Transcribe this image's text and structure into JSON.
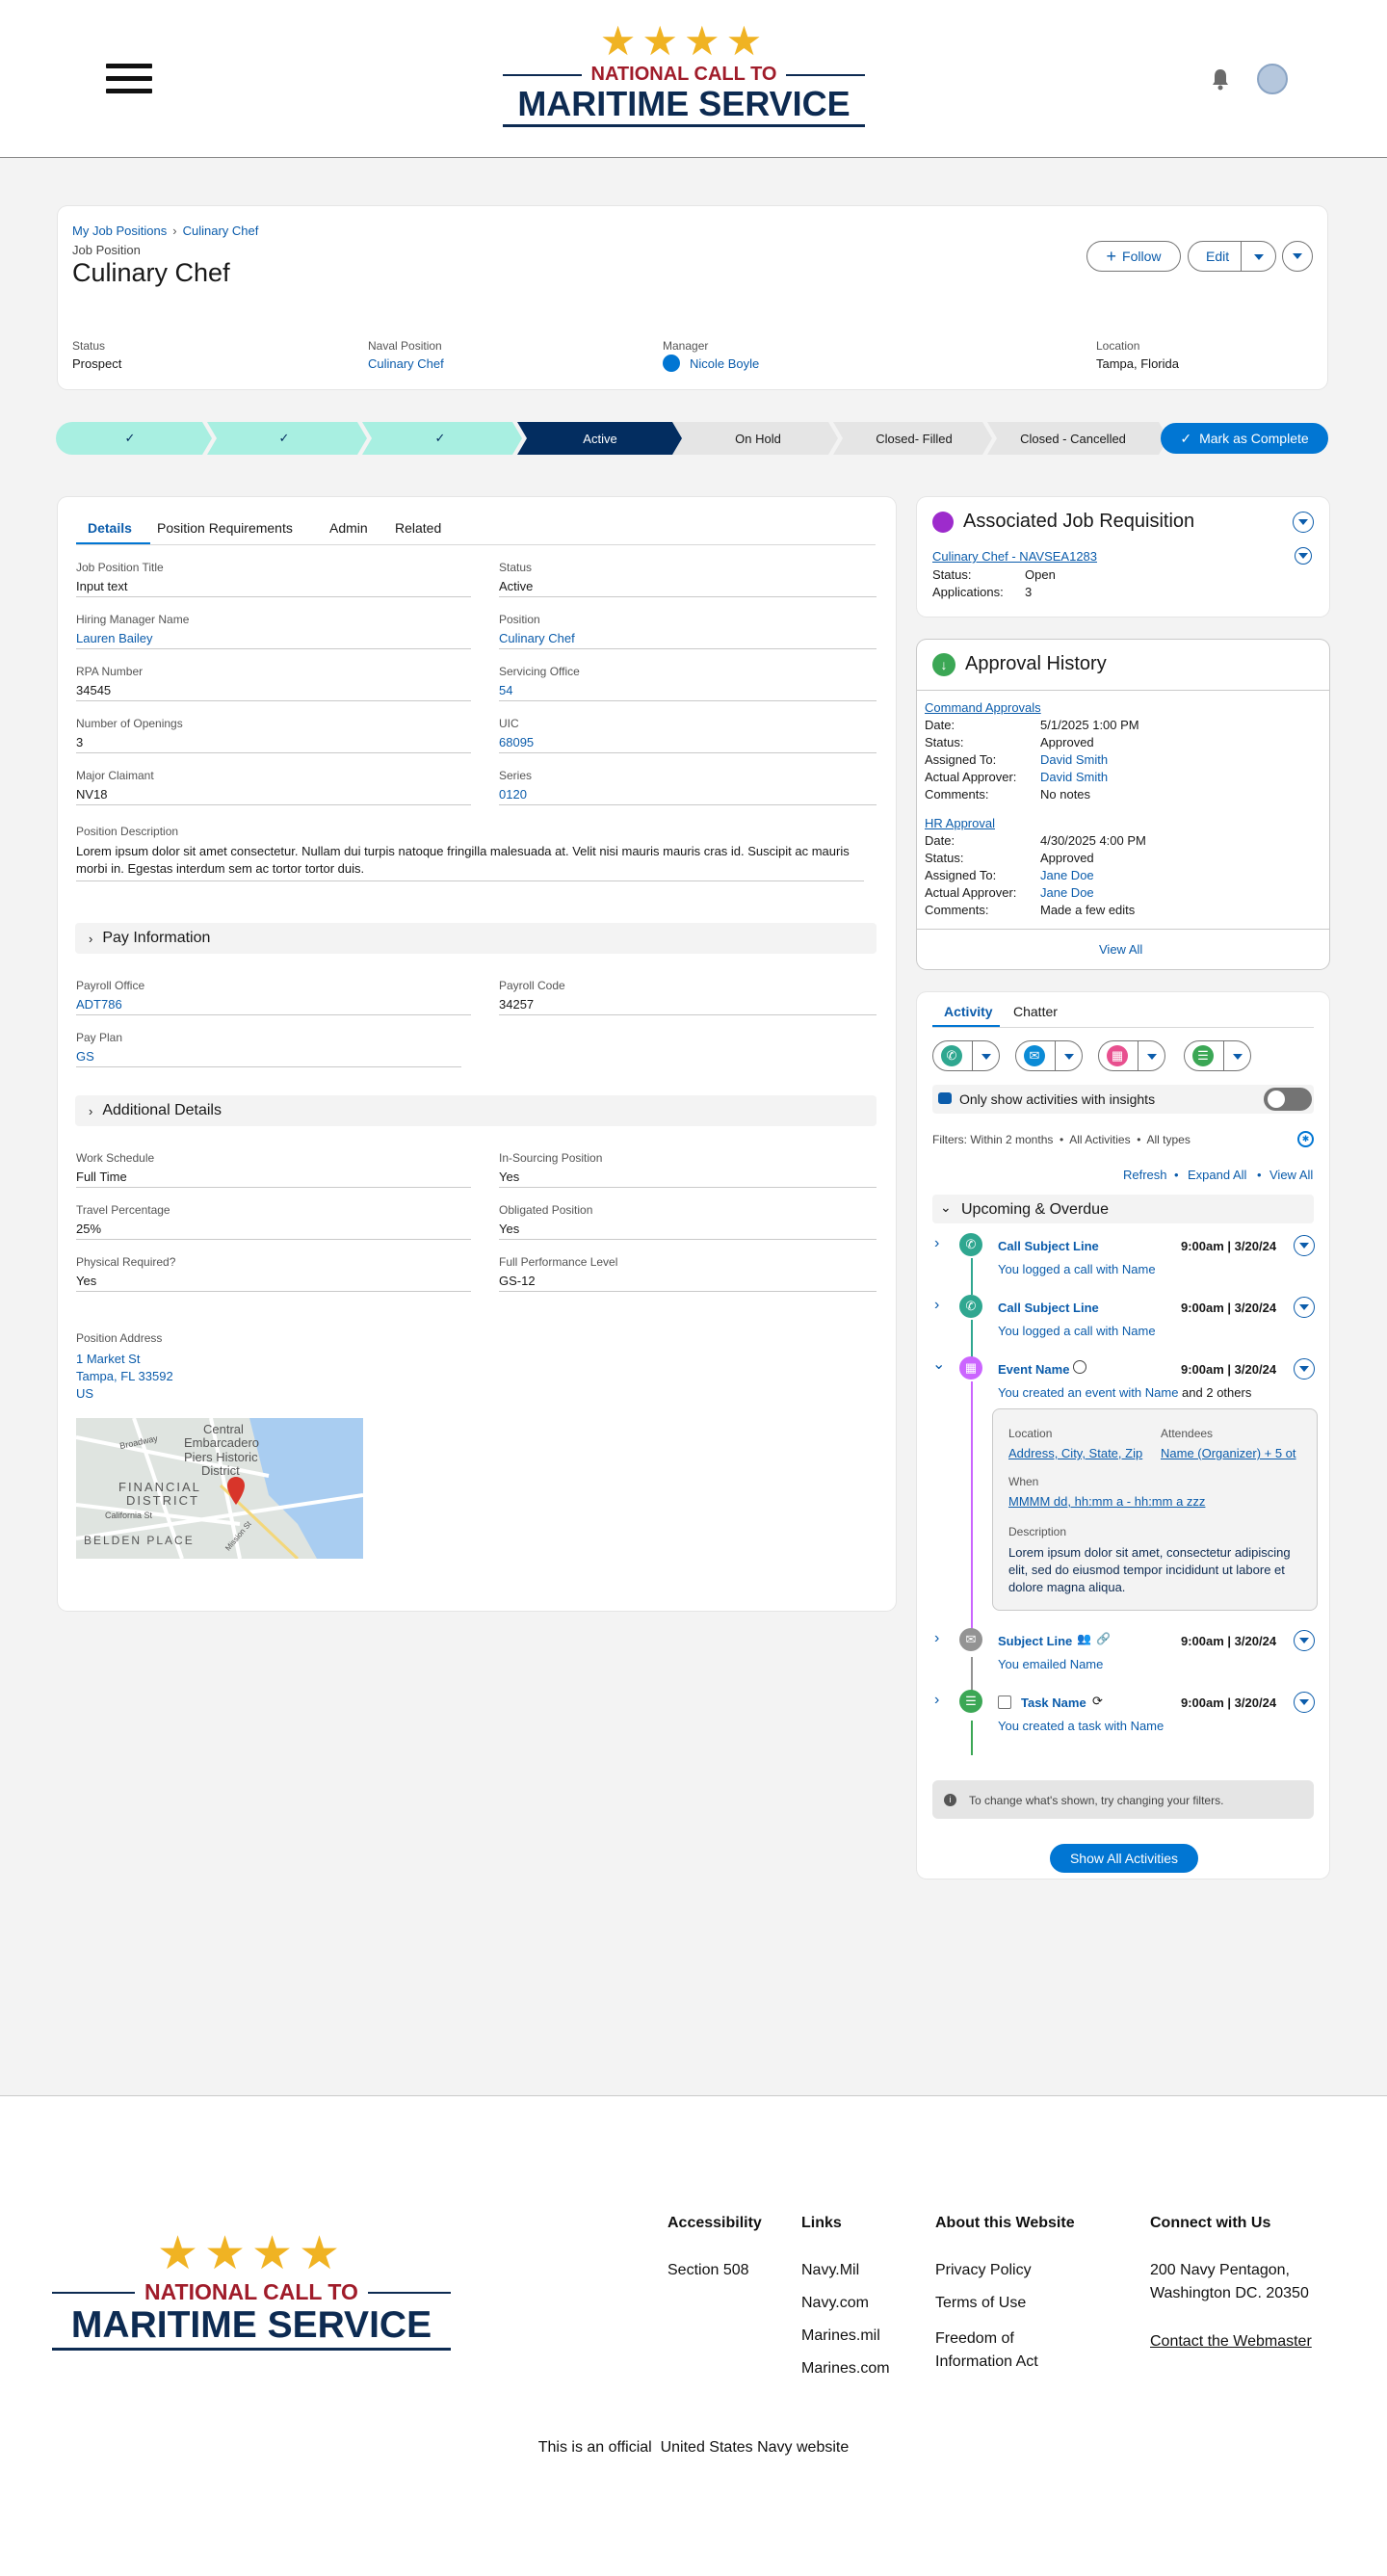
{
  "header": {
    "logo": {
      "line1": "NATIONAL CALL TO",
      "line2": "MARITIME SERVICE"
    }
  },
  "record": {
    "breadcrumb": {
      "parent": "My Job Positions",
      "current": "Culinary Chef"
    },
    "object_label": "Job Position",
    "title": "Culinary Chef",
    "actions": {
      "follow": "Follow",
      "edit": "Edit"
    },
    "highlights": [
      {
        "label": "Status",
        "value": "Prospect"
      },
      {
        "label": "Naval Position",
        "value": "Culinary Chef"
      },
      {
        "label": "Manager",
        "value": "Nicole Boyle"
      },
      {
        "label": "Location",
        "value": "Tampa, Florida"
      }
    ]
  },
  "path": {
    "stages": [
      "",
      "",
      "",
      "Active",
      "On Hold",
      "Closed- Filled",
      "Closed - Cancelled"
    ],
    "complete_button": "Mark as Complete"
  },
  "details": {
    "tabs": [
      "Details",
      "Position Requirements",
      "Admin",
      "Related"
    ],
    "fields": [
      {
        "label": "Job Position Title",
        "value": "Input text"
      },
      {
        "label": "Status",
        "value": "Active"
      },
      {
        "label": "Hiring Manager Name",
        "value": "Lauren Bailey"
      },
      {
        "label": "Position",
        "value": "Culinary Chef"
      },
      {
        "label": "RPA Number",
        "value": "34545"
      },
      {
        "label": "Servicing Office",
        "value": "54"
      },
      {
        "label": "Number of Openings",
        "value": "3"
      },
      {
        "label": "UIC",
        "value": "68095"
      },
      {
        "label": "Major Claimant",
        "value": "NV18"
      },
      {
        "label": "Series",
        "value": "0120"
      }
    ],
    "description": {
      "label": "Position Description",
      "value": "Lorem ipsum dolor sit amet consectetur. Nullam dui turpis natoque fringilla malesuada at. Velit nisi mauris mauris cras id. Suscipit ac mauris morbi in. Egestas interdum sem ac tortor tortor duis."
    },
    "pay_section": "Pay Information",
    "pay_fields": [
      {
        "label": "Payroll Office",
        "value": "ADT786"
      },
      {
        "label": "Payroll Code",
        "value": "34257"
      },
      {
        "label": "Pay Plan",
        "value": "GS"
      }
    ],
    "additional_section": "Additional Details",
    "additional_fields": [
      {
        "label": "Work Schedule",
        "value": "Full Time"
      },
      {
        "label": "In-Sourcing Position",
        "value": "Yes"
      },
      {
        "label": "Travel Percentage",
        "value": "25%"
      },
      {
        "label": "Obligated Position",
        "value": "Yes"
      },
      {
        "label": "Physical Required?",
        "value": "Yes"
      },
      {
        "label": "Full Performance Level",
        "value": "GS-12"
      }
    ],
    "address": {
      "label": "Position Address",
      "line1": "1 Market St",
      "line2": "Tampa, FL 33592",
      "line3": "US"
    },
    "map": {
      "l1": "Broadway",
      "l2": "Central",
      "l3": "Embarcadero",
      "l4": "Piers Historic",
      "l5": "District",
      "l6": "FINANCIAL",
      "l7": "DISTRICT",
      "l8": "California St",
      "l9": "BELDEN PLACE",
      "l10": "Mission St"
    }
  },
  "requisition": {
    "title": "Associated Job Requisition",
    "link": "Culinary Chef - NAVSEA1283",
    "status_label": "Status:",
    "status": "Open",
    "apps_label": "Applications:",
    "apps": "3"
  },
  "approval": {
    "title": "Approval History",
    "labels": {
      "date": "Date:",
      "status": "Status:",
      "assigned": "Assigned To:",
      "actual": "Actual Approver:",
      "comments": "Comments:"
    },
    "items": [
      {
        "name": "Command Approvals",
        "date": "5/1/2025 1:00 PM",
        "status": "Approved",
        "assigned": "David Smith",
        "actual": "David Smith",
        "comments": "No notes"
      },
      {
        "name": "HR Approval",
        "date": "4/30/2025 4:00 PM",
        "status": "Approved",
        "assigned": "Jane Doe",
        "actual": "Jane Doe",
        "comments": "Made a few edits"
      }
    ],
    "view_all": "View All"
  },
  "activity": {
    "tabs": [
      "Activity",
      "Chatter"
    ],
    "insights": "Only show activities with insights",
    "filters": "Filters: Within 2 months  •  All Activities  •  All types",
    "links": [
      "Refresh",
      "Expand All",
      "View All"
    ],
    "section": "Upcoming & Overdue",
    "items": [
      {
        "title": "Call Subject Line",
        "time": "9:00am | 3/20/24",
        "pre": "You logged a call with ",
        "name": "Name",
        "post": ""
      },
      {
        "title": "Call Subject Line",
        "time": "9:00am | 3/20/24",
        "pre": "You logged a call with ",
        "name": "Name",
        "post": ""
      },
      {
        "title": "Event Name",
        "time": "9:00am | 3/20/24",
        "pre": "You created an event with ",
        "name": "Name",
        "post": " and 2 others"
      },
      {
        "title": "Subject Line",
        "time": "9:00am | 3/20/24",
        "pre": "You emailed ",
        "name": "Name",
        "post": ""
      },
      {
        "title": "Task Name",
        "time": "9:00am | 3/20/24",
        "pre": "You created a task with ",
        "name": "Name",
        "post": ""
      }
    ],
    "event_detail": {
      "loc_label": "Location",
      "loc": "Address, City, State, Zip",
      "att_label": "Attendees",
      "att": "Name (Organizer) + 5 ot",
      "when_label": "When",
      "when": "MMMM dd, hh:mm a - hh:mm a zzz",
      "desc_label": "Description",
      "desc": "Lorem ipsum dolor sit amet, consectetur adipiscing elit, sed do eiusmod tempor incididunt ut labore et dolore magna aliqua."
    },
    "notice": "To change what's shown, try changing your filters.",
    "show_all": "Show All Activities"
  },
  "footer": {
    "logo": {
      "line1": "NATIONAL CALL TO",
      "line2": "MARITIME SERVICE"
    },
    "accessibility": {
      "heading": "Accessibility",
      "items": [
        "Section 508"
      ]
    },
    "links": {
      "heading": "Links",
      "items": [
        "Navy.Mil",
        "Navy.com",
        "Marines.mil",
        "Marines.com"
      ]
    },
    "about": {
      "heading": "About this Website",
      "items": [
        "Privacy Policy",
        "Terms of Use",
        "Freedom of Information Act"
      ]
    },
    "connect": {
      "heading": "Connect with Us",
      "address1": "200 Navy Pentagon,",
      "address2": "Washington DC. 20350",
      "contact": "Contact the Webmaster"
    },
    "official": "This is an official  United States Navy website"
  },
  "colors": {
    "brand": "#0176d3",
    "link": "#0b5cab",
    "complete": "#a8efe1",
    "current": "#032d60",
    "gold": "#f0b323",
    "red": "#a01c2a",
    "navy": "#0d2b52"
  }
}
